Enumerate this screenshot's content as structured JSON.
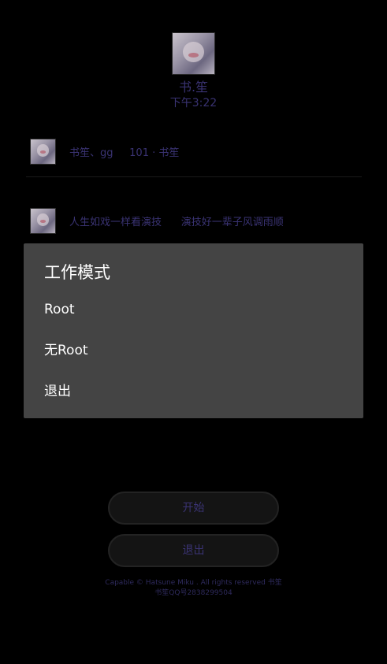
{
  "header": {
    "name": "书.笙",
    "time": "下午3:22"
  },
  "messages": [
    {
      "text": "书笙、gg     101 · 书笙"
    },
    {
      "text": "人生如戏一样看演技      演技好一辈子风调雨顺"
    }
  ],
  "dialog": {
    "title": "工作模式",
    "options": [
      "Root",
      "无Root",
      "退出"
    ]
  },
  "buttons": {
    "start_label": "开始",
    "exit_label": "退出"
  },
  "footer": {
    "line1": "Capable © Hatsune Miku . All rights reserved 书笙",
    "line2": "书笙QQ号2838299504"
  },
  "colors": {
    "background": "#000000",
    "accent_text": "#3a3373",
    "dialog_bg": "#444444"
  }
}
